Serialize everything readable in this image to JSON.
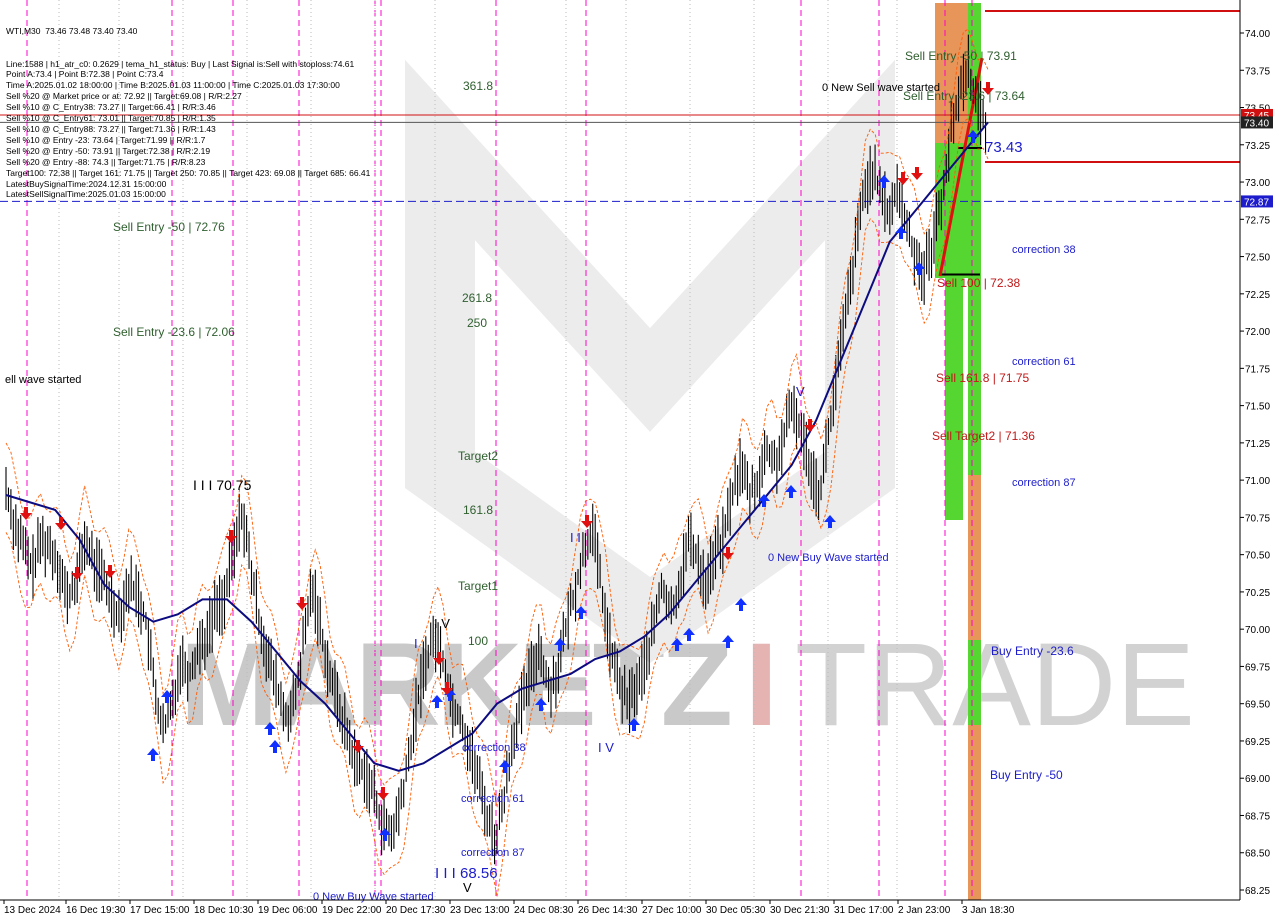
{
  "chart_data": {
    "type": "candlestick",
    "symbol": "WTI,M30",
    "ohlc_header": "73.46 73.48 73.40 73.40",
    "info_lines": [
      "Line:1588 | h1_atr_c0: 0.2629 | tema_h1_status: Buy | Last Signal is:Sell with stoploss:74.61",
      "Point A:73.4 | Point B:72.38 | Point C:73.4",
      "Time A:2025.01.02 18:00:00 | Time B:2025.01.03 11:00:00 | Time C:2025.01.03 17:30:00",
      "Sell %20 @ Market price or at: 72.92 || Target:69.08 | R/R:2.27",
      "Sell %10 @ C_Entry38: 73.27 || Target:66.41 | R/R:3.46",
      "Sell %10 @ C_Entry61: 73.01 || Target:70.85 | R/R:1.35",
      "Sell %10 @ C_Entry88: 73.27 || Target:71.36 | R/R:1.43",
      "Sell %10 @ Entry -23: 73.64 | Target:71.99 || R/R:1.7",
      "Sell %20 @ Entry -50: 73.91 || Target:72.38 | R/R:2.19",
      "Sell %20 @ Entry -88: 74.3 || Target:71.75 | R/R:8.23",
      "Target100: 72.38 || Target 161: 71.75 || Target 250: 70.85 || Target 423: 69.08 || Target 685: 66.41",
      "LatestBuySignalTime:2024.12.31 15:00:00",
      "LatestSellSignalTime:2025.01.03 15:00:00"
    ],
    "y_range": [
      68.2,
      74.15
    ],
    "y_ticks": [
      "74.00",
      "73.75",
      "73.50",
      "73.25",
      "73.00",
      "72.75",
      "72.50",
      "72.25",
      "72.00",
      "71.75",
      "71.50",
      "71.25",
      "71.00",
      "70.75",
      "70.50",
      "70.25",
      "70.00",
      "69.75",
      "69.50",
      "69.25",
      "69.00",
      "68.75",
      "68.50",
      "68.25"
    ],
    "y_tick_values": [
      74.0,
      73.75,
      73.5,
      73.25,
      73.0,
      72.75,
      72.5,
      72.25,
      72.0,
      71.75,
      71.5,
      71.25,
      71.0,
      70.75,
      70.5,
      70.25,
      70.0,
      69.75,
      69.5,
      69.25,
      69.0,
      68.75,
      68.5,
      68.25
    ],
    "x_labels": [
      "13 Dec 2024",
      "16 Dec 19:30",
      "17 Dec 15:00",
      "18 Dec 10:30",
      "19 Dec 06:00",
      "19 Dec 22:00",
      "20 Dec 17:30",
      "23 Dec 13:00",
      "24 Dec 08:30",
      "26 Dec 14:30",
      "27 Dec 10:00",
      "30 Dec 05:30",
      "30 Dec 21:30",
      "31 Dec 17:00",
      "2 Jan 23:00",
      "3 Jan 18:30"
    ],
    "price_badges": [
      {
        "label": "73.45",
        "value": 73.45,
        "color": "#d01010"
      },
      {
        "label": "73.40",
        "value": 73.4,
        "color": "#222222"
      },
      {
        "label": "72.87",
        "value": 72.87,
        "color": "#1c1ccc"
      }
    ],
    "close_path": [
      70.95,
      70.7,
      70.55,
      70.4,
      70.6,
      70.55,
      70.45,
      70.2,
      70.3,
      70.6,
      70.45,
      70.35,
      70.2,
      70.1,
      70.3,
      70.25,
      70.05,
      69.6,
      69.3,
      69.5,
      69.8,
      69.7,
      69.9,
      69.95,
      70.15,
      70.2,
      70.5,
      70.8,
      70.4,
      70.05,
      69.8,
      69.6,
      69.4,
      69.5,
      69.9,
      70.3,
      70.0,
      69.7,
      69.5,
      69.3,
      69.1,
      69.05,
      68.9,
      68.7,
      68.6,
      68.8,
      69.1,
      69.5,
      69.8,
      69.95,
      69.8,
      69.5,
      69.4,
      69.2,
      69.0,
      68.75,
      68.58,
      68.9,
      69.3,
      69.5,
      69.7,
      69.9,
      69.6,
      69.7,
      70.0,
      70.25,
      70.5,
      70.7,
      70.3,
      69.9,
      69.65,
      69.5,
      69.6,
      69.75,
      70.0,
      70.3,
      70.1,
      70.3,
      70.6,
      70.5,
      70.3,
      70.5,
      70.6,
      70.9,
      71.1,
      70.9,
      71.0,
      71.2,
      71.1,
      71.3,
      71.5,
      71.3,
      71.1,
      70.9,
      71.3,
      71.7,
      72.1,
      72.5,
      72.9,
      73.1,
      72.9,
      72.8,
      72.95,
      72.7,
      72.5,
      72.4,
      72.6,
      72.9,
      73.3,
      73.6,
      73.8,
      73.5,
      73.4
    ],
    "support_ema": [
      70.9,
      70.85,
      70.8,
      70.6,
      70.3,
      70.15,
      70.05,
      70.1,
      70.2,
      70.2,
      70.05,
      69.85,
      69.65,
      69.5,
      69.3,
      69.1,
      69.05,
      69.1,
      69.2,
      69.3,
      69.5,
      69.6,
      69.65,
      69.7,
      69.8,
      69.85,
      69.95,
      70.1,
      70.3,
      70.5,
      70.7,
      70.9,
      71.1,
      71.4,
      71.8,
      72.2,
      72.6,
      72.8,
      73.0,
      73.2,
      73.4
    ],
    "overlay_labels": [
      {
        "text": "Sell Entry -50 | 72.76",
        "value": 72.76,
        "color": "#2f5f2f"
      },
      {
        "text": "Sell Entry -23.6 | 72.06",
        "value": 72.06,
        "color": "#2f5f2f"
      },
      {
        "text": "Sell Entry -50 | 73.91",
        "value": 73.91,
        "color": "#2f5f2f"
      },
      {
        "text": "Sell Entry -23.6 | 73.64",
        "value": 73.64,
        "color": "#2f5f2f"
      },
      {
        "text": "Sell 100 | 72.38",
        "value": 72.38,
        "color": "#c01818"
      },
      {
        "text": "Sell 161.8 | 71.75",
        "value": 71.75,
        "color": "#c01818"
      },
      {
        "text": "Sell Target2 | 71.36",
        "value": 71.36,
        "color": "#c01818"
      },
      {
        "text": "73.43",
        "value": 73.43,
        "color": "#1c1ccc"
      },
      {
        "text": "correction 38",
        "value": 72.6,
        "color": "#1c1ccc"
      },
      {
        "text": "correction 61",
        "value": 71.85,
        "color": "#1c1ccc"
      },
      {
        "text": "correction 87",
        "value": 71.0,
        "color": "#1c1ccc"
      },
      {
        "text": "Buy Entry -23.6",
        "value": 69.8,
        "color": "#1c1ccc"
      },
      {
        "text": "Buy Entry -50",
        "value": 69.0,
        "color": "#1c1ccc"
      },
      {
        "text": "361.8",
        "value": 73.4,
        "color": "#2f5f2f"
      },
      {
        "text": "261.8",
        "value": 72.2,
        "color": "#2f5f2f"
      },
      {
        "text": "250",
        "value": 72.05,
        "color": "#2f5f2f"
      },
      {
        "text": "Target2",
        "value": 71.15,
        "color": "#2f5f2f"
      },
      {
        "text": "161.8",
        "value": 70.85,
        "color": "#2f5f2f"
      },
      {
        "text": "Target1",
        "value": 70.25,
        "color": "#2f5f2f"
      },
      {
        "text": "100",
        "value": 69.95,
        "color": "#2f5f2f"
      },
      {
        "text": "correction 38",
        "value": 69.22,
        "color": "#1c1ccc"
      },
      {
        "text": "correction 61",
        "value": 68.9,
        "color": "#1c1ccc"
      },
      {
        "text": "correction 87",
        "value": 68.55,
        "color": "#1c1ccc"
      },
      {
        "text": "I I I 68.56",
        "value": 68.45,
        "color": "#1c1ccc"
      },
      {
        "text": "I I I 70.75",
        "value": 70.95,
        "color": "#000000"
      },
      {
        "text": "0 New Buy Wave started",
        "value": 68.25,
        "color": "#1c1ccc"
      },
      {
        "text": "0 New Buy Wave started",
        "value": 70.5,
        "color": "#1c1ccc"
      },
      {
        "text": "0 New Sell wave started",
        "value": 73.8,
        "color": "#000000"
      },
      {
        "text": "ell wave started",
        "value": 71.75,
        "color": "#000000"
      },
      {
        "text": "I V",
        "value": 70.05,
        "color": "#000000"
      },
      {
        "text": "I V",
        "value": 69.22,
        "color": "#1c1ccc"
      },
      {
        "text": "I I",
        "value": 70.65,
        "color": "#1c1ccc"
      },
      {
        "text": "V",
        "value": 71.6,
        "color": "#1c1ccc"
      },
      {
        "text": "I",
        "value": 69.95,
        "color": "#1c1ccc"
      },
      {
        "text": "V",
        "value": 68.3,
        "color": "#000000"
      }
    ],
    "colors": {
      "candles": "#000000",
      "ema": "#0c0c80",
      "envelope": "#ff5a00",
      "session_line": "#ff00cc",
      "buy_arrow": "#1030ff",
      "sell_arrow": "#e01010",
      "zone_orange": "#e8955a",
      "zone_green": "#55d630",
      "watermark": "#b0b0b0"
    },
    "watermark": {
      "text_left": "MARKETZ",
      "text_mid": "I",
      "text_right": "TRADE"
    }
  }
}
